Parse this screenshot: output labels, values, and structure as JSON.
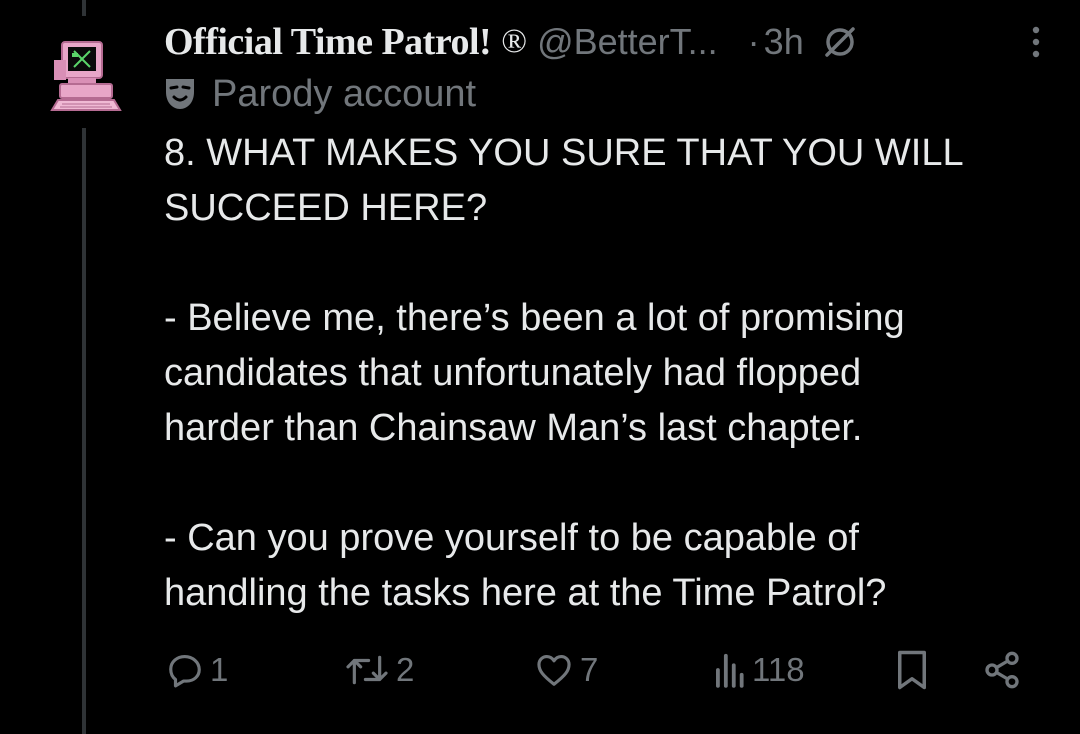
{
  "tweet": {
    "display_name": "Official Time Patrol!",
    "registered_mark": "®",
    "handle": "@BetterT...",
    "separator": "·",
    "time": "3h",
    "label": "Parody account",
    "body": "8. WHAT MAKES YOU SURE THAT YOU WILL\nSUCCEED HERE?\n\n- Believe me, there’s been a lot of promising\ncandidates that unfortunately had flopped\nharder than Chainsaw Man’s last chapter.\n\n- Can you prove yourself to be capable of\nhandling the tasks here at the Time Patrol?"
  },
  "actions": {
    "replies": "1",
    "reposts": "2",
    "likes": "7",
    "views": "118"
  },
  "icons": {
    "avatar": "retro-computer-avatar",
    "grok": "grok-icon",
    "more": "more-options-icon",
    "parody": "parody-mask-icon",
    "reply": "reply-icon",
    "repost": "repost-icon",
    "like": "heart-icon",
    "views": "views-chart-icon",
    "bookmark": "bookmark-icon",
    "share": "share-icon"
  },
  "colors": {
    "background": "#000000",
    "text": "#e7e9ea",
    "secondary": "#71767b",
    "thread_line": "#2f3336",
    "avatar_pink": "#e8a6c8"
  }
}
